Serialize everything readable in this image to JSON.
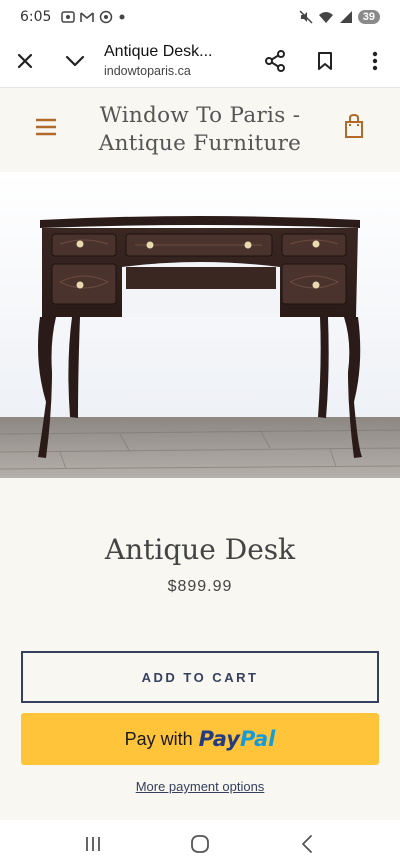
{
  "status_bar": {
    "time": "6:05",
    "battery": "39",
    "left_icons": [
      "screenshot-icon",
      "gmail-icon",
      "chrome-icon",
      "dot-icon"
    ],
    "right_icons": [
      "mute-icon",
      "wifi-icon",
      "signal-icon"
    ]
  },
  "browser": {
    "page_title": "Antique Desk...",
    "url": "indowtoparis.ca"
  },
  "site": {
    "name_line1": "Window To Paris -",
    "name_line2": "Antique Furniture"
  },
  "product": {
    "title": "Antique Desk",
    "price": "$899.99",
    "add_to_cart": "ADD TO CART",
    "paypal_prefix": "Pay with",
    "paypal_brand_1": "Pay",
    "paypal_brand_2": "Pal",
    "more_payment": "More payment options"
  },
  "colors": {
    "accent": "#b06a2c",
    "navy": "#34405e",
    "paypal_yellow": "#ffc439",
    "background": "#f8f7f1"
  }
}
